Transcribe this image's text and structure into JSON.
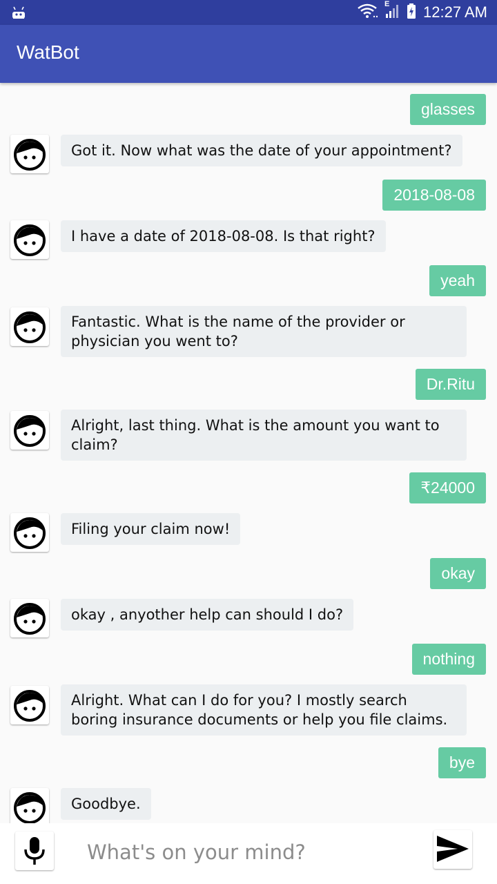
{
  "status_bar": {
    "time": "12:27 AM",
    "network_type": "E",
    "icons": [
      "android-icon",
      "wifi-icon",
      "signal-icon",
      "battery-charging-icon"
    ]
  },
  "app_bar": {
    "title": "WatBot"
  },
  "colors": {
    "status_bar": "#2f3e9e",
    "app_bar": "#3f51b5",
    "user_bubble": "#66cba3",
    "bot_bubble": "#eceff1",
    "background": "#fafafa"
  },
  "messages": [
    {
      "sender": "user",
      "text": "glasses"
    },
    {
      "sender": "bot",
      "text": "Got it. Now what was the date of your appointment?"
    },
    {
      "sender": "user",
      "text": "2018-08-08"
    },
    {
      "sender": "bot",
      "text": "I have a date of 2018-08-08. Is that right?"
    },
    {
      "sender": "user",
      "text": "yeah"
    },
    {
      "sender": "bot",
      "text": "Fantastic. What is the name of the provider or physician you went to?"
    },
    {
      "sender": "user",
      "text": "Dr.Ritu"
    },
    {
      "sender": "bot",
      "text": "Alright, last thing. What is the amount you want to claim?"
    },
    {
      "sender": "user",
      "text": "₹24000"
    },
    {
      "sender": "bot",
      "text": "Filing your claim now!"
    },
    {
      "sender": "user",
      "text": "okay"
    },
    {
      "sender": "bot",
      "text": "okay , anyother help can should I do?"
    },
    {
      "sender": "user",
      "text": "nothing"
    },
    {
      "sender": "bot",
      "text": "Alright. What can I do for you? I mostly search boring insurance documents or help you file claims."
    },
    {
      "sender": "user",
      "text": "bye"
    },
    {
      "sender": "bot",
      "text": "Goodbye."
    }
  ],
  "input": {
    "placeholder": "What's on your mind?",
    "value": "",
    "mic_icon": "microphone-icon",
    "send_icon": "send-icon"
  }
}
